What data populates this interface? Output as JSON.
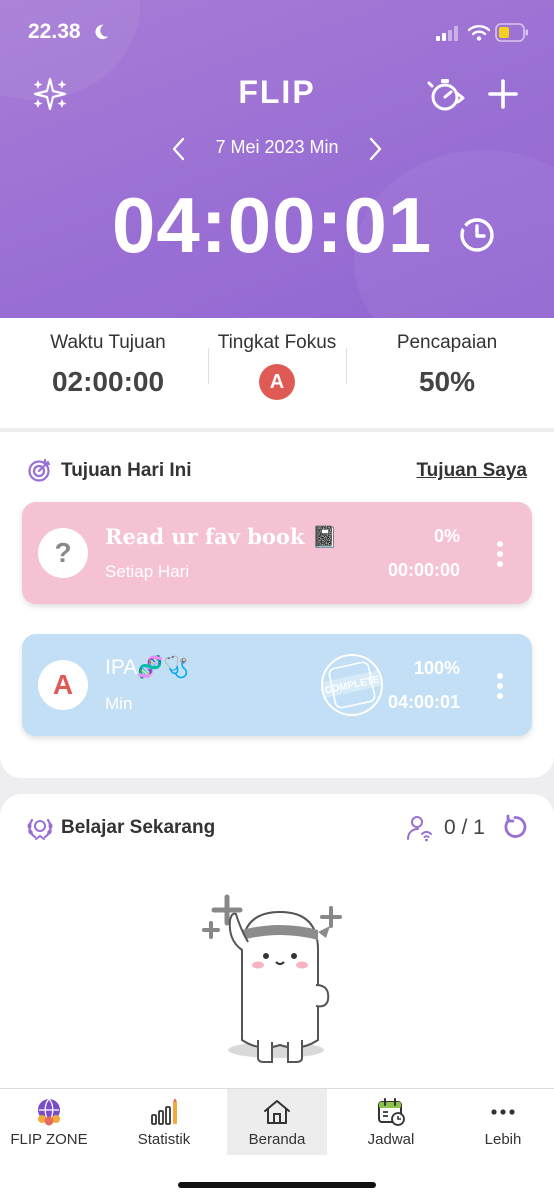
{
  "status_bar": {
    "time": "22.38"
  },
  "header": {
    "logo": "FLIP",
    "date": "7 Mei 2023 Min",
    "total_time": "04:00:01"
  },
  "stats": {
    "goal_time_label": "Waktu Tujuan",
    "goal_time_value": "02:00:00",
    "focus_label": "Tingkat Fokus",
    "focus_value": "A",
    "achievement_label": "Pencapaian",
    "achievement_value": "50%"
  },
  "goals": {
    "title": "Tujuan Hari Ini",
    "link": "Tujuan Saya",
    "items": [
      {
        "avatar": "?",
        "name": "Read ur fav book 📓",
        "subtitle": "Setiap Hari",
        "percent": "0%",
        "time": "00:00:00",
        "color": "#f5c2d3"
      },
      {
        "avatar": "A",
        "name": "IPA🧬🩺",
        "subtitle": "Min",
        "percent": "100%",
        "time": "04:00:01",
        "color": "#c2dff5",
        "stamp": "COMPLETE"
      }
    ]
  },
  "study": {
    "title": "Belajar Sekarang",
    "count": "0 / 1"
  },
  "nav": {
    "items": [
      {
        "label": "FLIP ZONE",
        "icon": "flip-zone-icon"
      },
      {
        "label": "Statistik",
        "icon": "statistics-icon"
      },
      {
        "label": "Beranda",
        "icon": "home-icon",
        "active": true
      },
      {
        "label": "Jadwal",
        "icon": "calendar-icon"
      },
      {
        "label": "Lebih",
        "icon": "more-icon"
      }
    ]
  },
  "colors": {
    "header_purple": "#9a6fd4",
    "focus_red": "#e05a55",
    "pink_card": "#f5c2d3",
    "blue_card": "#c2dff5",
    "accent_purple": "#9a6fd4"
  }
}
